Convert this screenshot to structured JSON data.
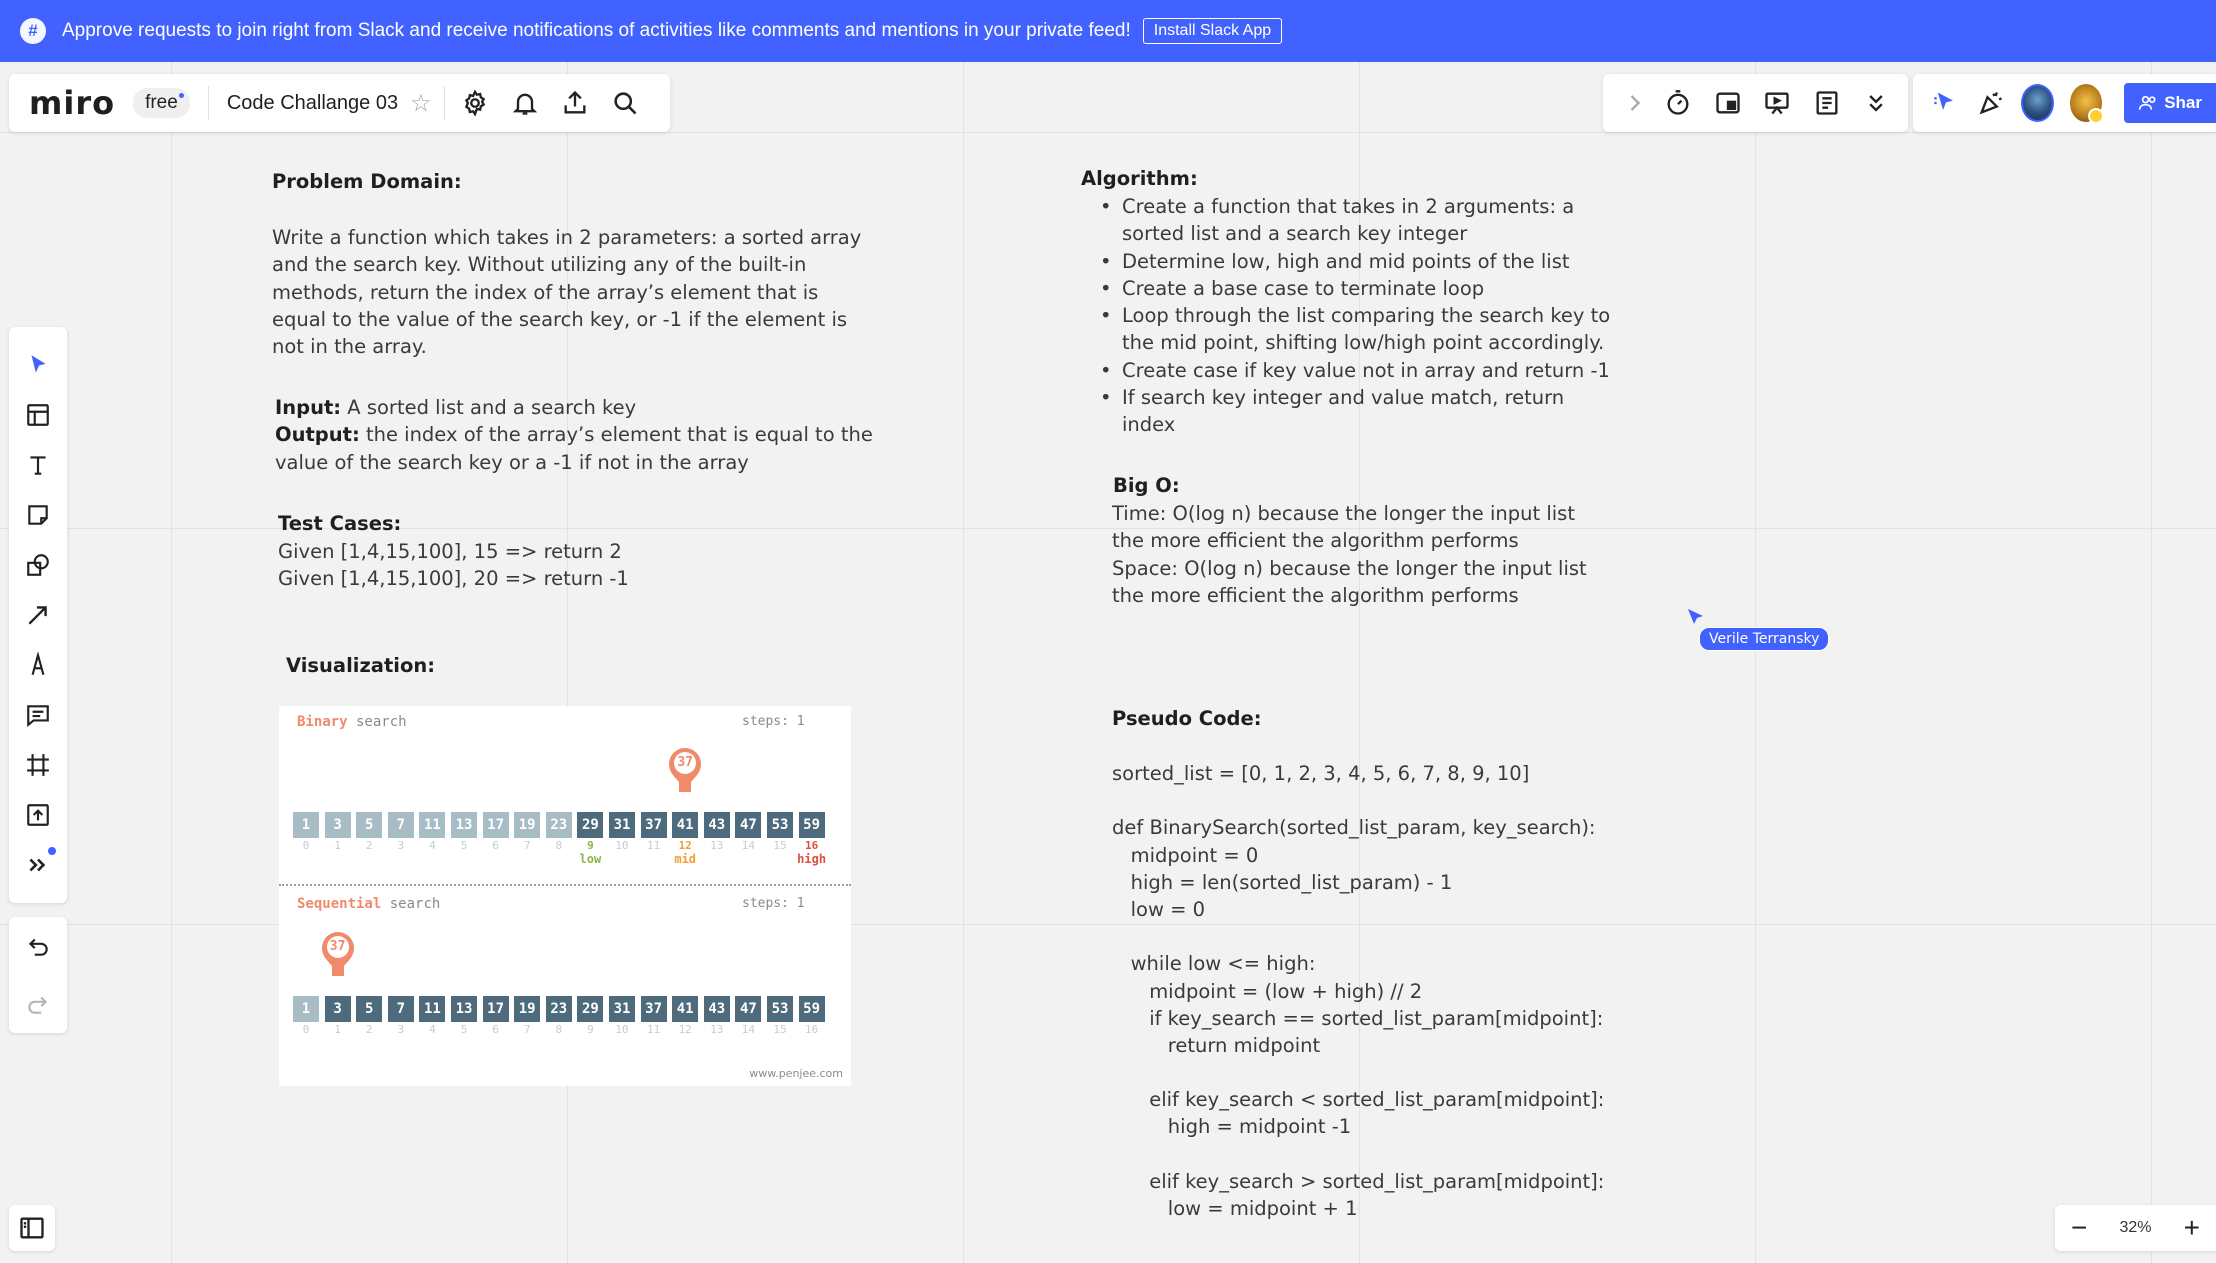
{
  "banner": {
    "message": "Approve requests to join right from Slack and receive notifications of activities like comments and mentions in your private feed!",
    "button": "Install Slack App"
  },
  "board": {
    "logo": "miro",
    "plan": "free",
    "title": "Code Challange 03"
  },
  "collab": {
    "share_label": "Shar"
  },
  "zoom": {
    "minus": "−",
    "level": "32%",
    "plus": "+"
  },
  "content": {
    "problem_heading": "Problem Domain:",
    "problem_lines": [
      "Write a function which takes in 2 parameters: a sorted array",
      "and the search key. Without utilizing any of the built-in",
      "methods, return the index of the array’s element that is",
      "equal to the value of the search key, or -1 if the element is",
      "not in the array."
    ],
    "input_label": "Input:",
    "input_text": " A sorted list and a search key",
    "output_label": "Output:",
    "output_text_1": " the index of the array’s element that is equal to the",
    "output_text_2": "value of the search key or a -1 if not in the array",
    "tests_heading": "Test Cases:",
    "tests": [
      "Given [1,4,15,100], 15 => return 2",
      "Given [1,4,15,100], 20 => return -1"
    ],
    "viz_heading": "Visualization:",
    "algo_heading": "Algorithm:",
    "algo_items": [
      [
        "Create a function that takes in 2 arguments: a",
        "sorted list and a search key integer"
      ],
      [
        "Determine low, high and mid points of the list"
      ],
      [
        "Create a base case to terminate loop"
      ],
      [
        "Loop through the list comparing the search key to",
        "the mid point, shifting low/high point accordingly."
      ],
      [
        "Create case if key value not in array and return -1"
      ],
      [
        "If search key integer and value match, return",
        "index"
      ]
    ],
    "bigo_heading": "Big O:",
    "bigo_lines": [
      "Time: O(log n) because the longer the input list",
      "the more efficient the algorithm performs",
      "Space: O(log n) because the longer the input list",
      "the more efficient the algorithm performs"
    ],
    "pseudo_heading": "Pseudo Code:",
    "pseudo_lines": [
      "sorted_list = [0, 1, 2, 3, 4, 5, 6, 7, 8, 9, 10]",
      "",
      "def BinarySearch(sorted_list_param, key_search):",
      "   midpoint = 0",
      "   high = len(sorted_list_param) - 1",
      "   low = 0",
      "",
      "   while low <= high:",
      "      midpoint = (low + high) // 2",
      "      if key_search == sorted_list_param[midpoint]:",
      "         return midpoint",
      "",
      "      elif key_search < sorted_list_param[midpoint]:",
      "         high = midpoint -1",
      "",
      "      elif key_search > sorted_list_param[midpoint]:",
      "         low = midpoint + 1"
    ]
  },
  "visualization": {
    "binary_title_kw": "Binary",
    "binary_title_rest": " search",
    "binary_steps": "steps: 1",
    "sequential_title_kw": "Sequential",
    "sequential_title_rest": " search",
    "sequential_steps": "steps: 1",
    "target": "37",
    "values": [
      "1",
      "3",
      "5",
      "7",
      "11",
      "13",
      "17",
      "19",
      "23",
      "29",
      "31",
      "37",
      "41",
      "43",
      "47",
      "53",
      "59"
    ],
    "indices": [
      "0",
      "1",
      "2",
      "3",
      "4",
      "5",
      "6",
      "7",
      "8",
      "9",
      "10",
      "11",
      "12",
      "13",
      "14",
      "15",
      "16"
    ],
    "low_label": "low",
    "mid_label": "mid",
    "high_label": "high",
    "credit": "www.penjee.com",
    "colors": {
      "low": "#8bb44a",
      "mid": "#f0a030",
      "high": "#e0503a",
      "pin": "#f08a6a"
    }
  },
  "remote_cursor": {
    "name": "Verile Terransky",
    "color": "#4262ff"
  }
}
